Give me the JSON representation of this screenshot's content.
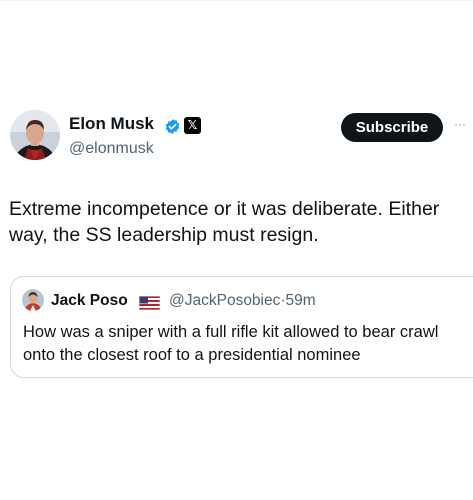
{
  "author": {
    "name": "Elon Musk",
    "handle": "@elonmusk",
    "avatar_icon": "elon-avatar",
    "verified_icon": "verified-badge-icon",
    "affiliate_label": "𝕏",
    "verified_color": "#1d9bf0"
  },
  "actions": {
    "subscribe_label": "Subscribe",
    "more_label": "···"
  },
  "tweet": {
    "text": "Extreme incompetence or it was deliberate. Either way, the SS leadership must resign."
  },
  "quoted": {
    "name": "Jack Poso",
    "flag_icon": "us-flag-icon",
    "handle": "@JackPosobiec",
    "separator": "·",
    "time": "59m",
    "text": "How was a sniper with a full rifle kit allowed to bear crawl onto the closest roof to a presidential nominee"
  },
  "colors": {
    "text": "#0f1419",
    "secondary": "#536471",
    "border": "#cfd9de",
    "button_bg": "#0f1419"
  }
}
